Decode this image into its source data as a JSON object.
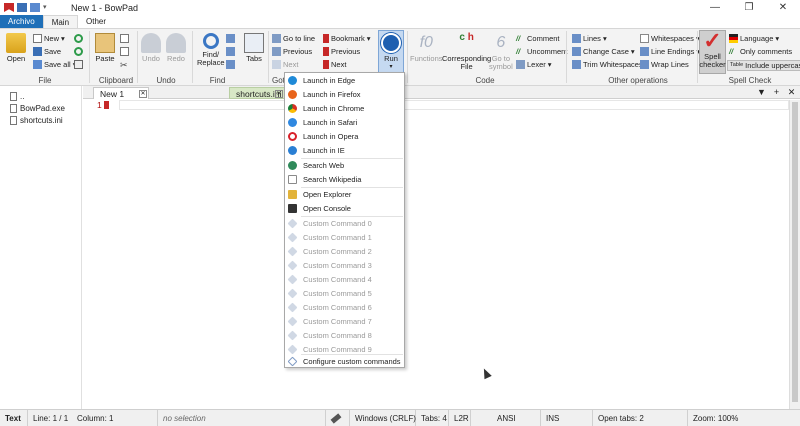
{
  "window": {
    "title": "New 1 - BowPad",
    "controls": [
      "—",
      "❐",
      "✕"
    ]
  },
  "ribbon_tabs": [
    {
      "label": "Archivo"
    },
    {
      "label": "Main"
    },
    {
      "label": "Other"
    }
  ],
  "ribbon": {
    "file": {
      "label": "File",
      "open": "Open",
      "new": "New",
      "save": "Save",
      "save_all": "Save all"
    },
    "clipboard": {
      "label": "Clipboard",
      "paste": "Paste"
    },
    "undo": {
      "label": "Undo",
      "undo": "Undo",
      "redo": "Redo"
    },
    "find": {
      "label": "Find",
      "find_replace_1": "Find/",
      "find_replace_2": "Replace",
      "tabs": "Tabs"
    },
    "goto": {
      "label": "Got",
      "go_to_line": "Go to line",
      "previous": "Previous",
      "next": "Next"
    },
    "bookmarks": {
      "bookmark": "Bookmark",
      "previous": "Previous",
      "next": "Next"
    },
    "run": {
      "label": "Run"
    },
    "code": {
      "label": "Code",
      "functions": "Functions",
      "corresponding_1": "Corresponding",
      "corresponding_2": "File",
      "goto_symbol_1": "Go to",
      "goto_symbol_2": "symbol",
      "comment": "Comment",
      "uncomment": "Uncomment",
      "lexer": "Lexer"
    },
    "other_ops": {
      "label": "Other operations",
      "lines": "Lines",
      "change_case": "Change Case",
      "trim_whitespaces": "Trim Whitespaces",
      "whitespaces": "Whitespaces",
      "line_endings": "Line Endings",
      "wrap_lines": "Wrap Lines"
    },
    "spell": {
      "label": "Spell Check",
      "spell_checker_1": "Spell",
      "spell_checker_2": "checker",
      "language": "Language",
      "only_comments": "Only comments",
      "include_uppercase": "Include uppercase",
      "include_uppercase_prefix": "Table"
    }
  },
  "tree": {
    "items": [
      {
        "label": ".."
      },
      {
        "label": "BowPad.exe"
      },
      {
        "label": "shortcuts.ini"
      }
    ]
  },
  "doc_tabs": [
    {
      "label": "New 1"
    },
    {
      "label": "shortcuts.ini"
    }
  ],
  "doc_tab_controls": [
    "▼",
    "+",
    "✕"
  ],
  "editor": {
    "line_number": "1"
  },
  "run_menu": {
    "items": [
      {
        "label": "Launch in Edge",
        "color": "#1f8ad8"
      },
      {
        "label": "Launch in Firefox",
        "color": "#e8641b"
      },
      {
        "label": "Launch in Chrome",
        "color": "#3c9a3c"
      },
      {
        "label": "Launch in Safari",
        "color": "#2f88e0"
      },
      {
        "label": "Launch in Opera",
        "color": "#d8202a"
      },
      {
        "label": "Launch in IE",
        "color": "#2a7fd4"
      },
      {
        "label": "Search Web",
        "color": "#2f8a5a"
      },
      {
        "label": "Search Wikipedia",
        "color": "#8a8a8a"
      },
      {
        "label": "Open Explorer",
        "color": "#e2b33a"
      },
      {
        "label": "Open Console",
        "color": "#333333"
      },
      {
        "label": "Custom Command 0"
      },
      {
        "label": "Custom Command 1"
      },
      {
        "label": "Custom Command 2"
      },
      {
        "label": "Custom Command 3"
      },
      {
        "label": "Custom Command 4"
      },
      {
        "label": "Custom Command 5"
      },
      {
        "label": "Custom Command 6"
      },
      {
        "label": "Custom Command 7"
      },
      {
        "label": "Custom Command 8"
      },
      {
        "label": "Custom Command 9"
      },
      {
        "label": "Configure custom commands",
        "color": "#7f9bc4"
      }
    ]
  },
  "status": {
    "mode": "Text",
    "position": "Line: 1 / 1    Column: 1",
    "selection": "no selection",
    "eol": "Windows (CRLF)",
    "tabs": "Tabs: 4",
    "dir": "L2R",
    "encoding": "ANSI",
    "ins": "INS",
    "open_tabs": "Open tabs: 2",
    "zoom": "Zoom: 100%"
  },
  "colors": {
    "accent": "#1e6fb8",
    "run_button": "#c5d9f1",
    "spell_check": "#d32f2f"
  }
}
